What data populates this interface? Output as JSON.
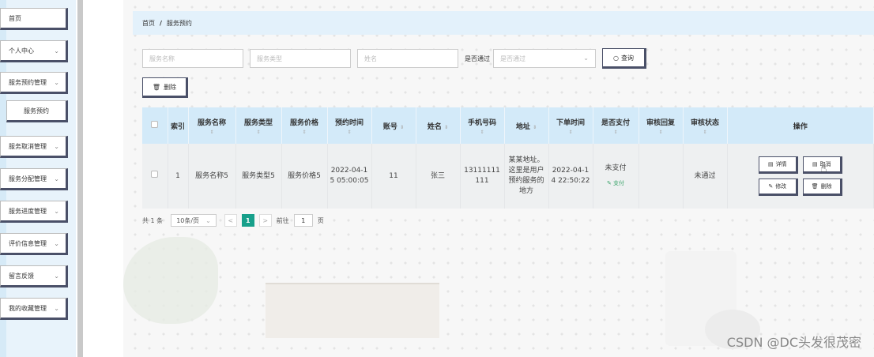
{
  "sidebar": {
    "items": [
      {
        "label": "首页",
        "chevron": false
      },
      {
        "label": "个人中心",
        "chevron": true
      },
      {
        "label": "服务预约管理",
        "chevron": true
      },
      {
        "label": "服务预约",
        "chevron": false
      },
      {
        "label": "服务取消管理",
        "chevron": true
      },
      {
        "label": "服务分配管理",
        "chevron": true
      },
      {
        "label": "服务进度管理",
        "chevron": true
      },
      {
        "label": "评价信息管理",
        "chevron": true
      },
      {
        "label": "留言反馈",
        "chevron": true
      },
      {
        "label": "我的收藏管理",
        "chevron": true
      }
    ]
  },
  "breadcrumb": {
    "home": "首页",
    "separator": "/",
    "current": "服务预约"
  },
  "search": {
    "service_name_placeholder": "服务名称",
    "service_type_placeholder": "服务类型",
    "name_placeholder": "姓名",
    "approved_label": "是否通过",
    "approved_placeholder": "是否通过",
    "query_label": "查询"
  },
  "toolbar": {
    "delete_label": "删除"
  },
  "table": {
    "headers": {
      "index": "索引",
      "service_name": "服务名称",
      "service_type": "服务类型",
      "service_price": "服务价格",
      "booking_time": "预约时间",
      "account": "账号",
      "name": "姓名",
      "phone": "手机号码",
      "address": "地址",
      "order_time": "下单时间",
      "paid": "是否支付",
      "review_reply": "审核回复",
      "review_status": "审核状态",
      "actions": "操作"
    },
    "rows": [
      {
        "index": "1",
        "service_name": "服务名称5",
        "service_type": "服务类型5",
        "service_price": "服务价格5",
        "booking_time": "2022-04-15 05:00:05",
        "account": "11",
        "name": "张三",
        "phone": "13111111111",
        "address": "某某地址。这里是用户预约服务的地方",
        "order_time": "2022-04-14 22:50:22",
        "paid": "未支付",
        "pay_link": "支付",
        "review_reply": "",
        "review_status": "未通过",
        "actions": {
          "detail": "详情",
          "cancel": "取消",
          "edit": "修改",
          "delete": "删除"
        }
      }
    ]
  },
  "pagination": {
    "total": "共 1 条",
    "page_size": "10条/页",
    "prev": "<",
    "current_page": "1",
    "next": ">",
    "goto_label": "前往",
    "goto_value": "1",
    "page_suffix": "页"
  },
  "watermark": "CSDN @DC头发很茂密"
}
